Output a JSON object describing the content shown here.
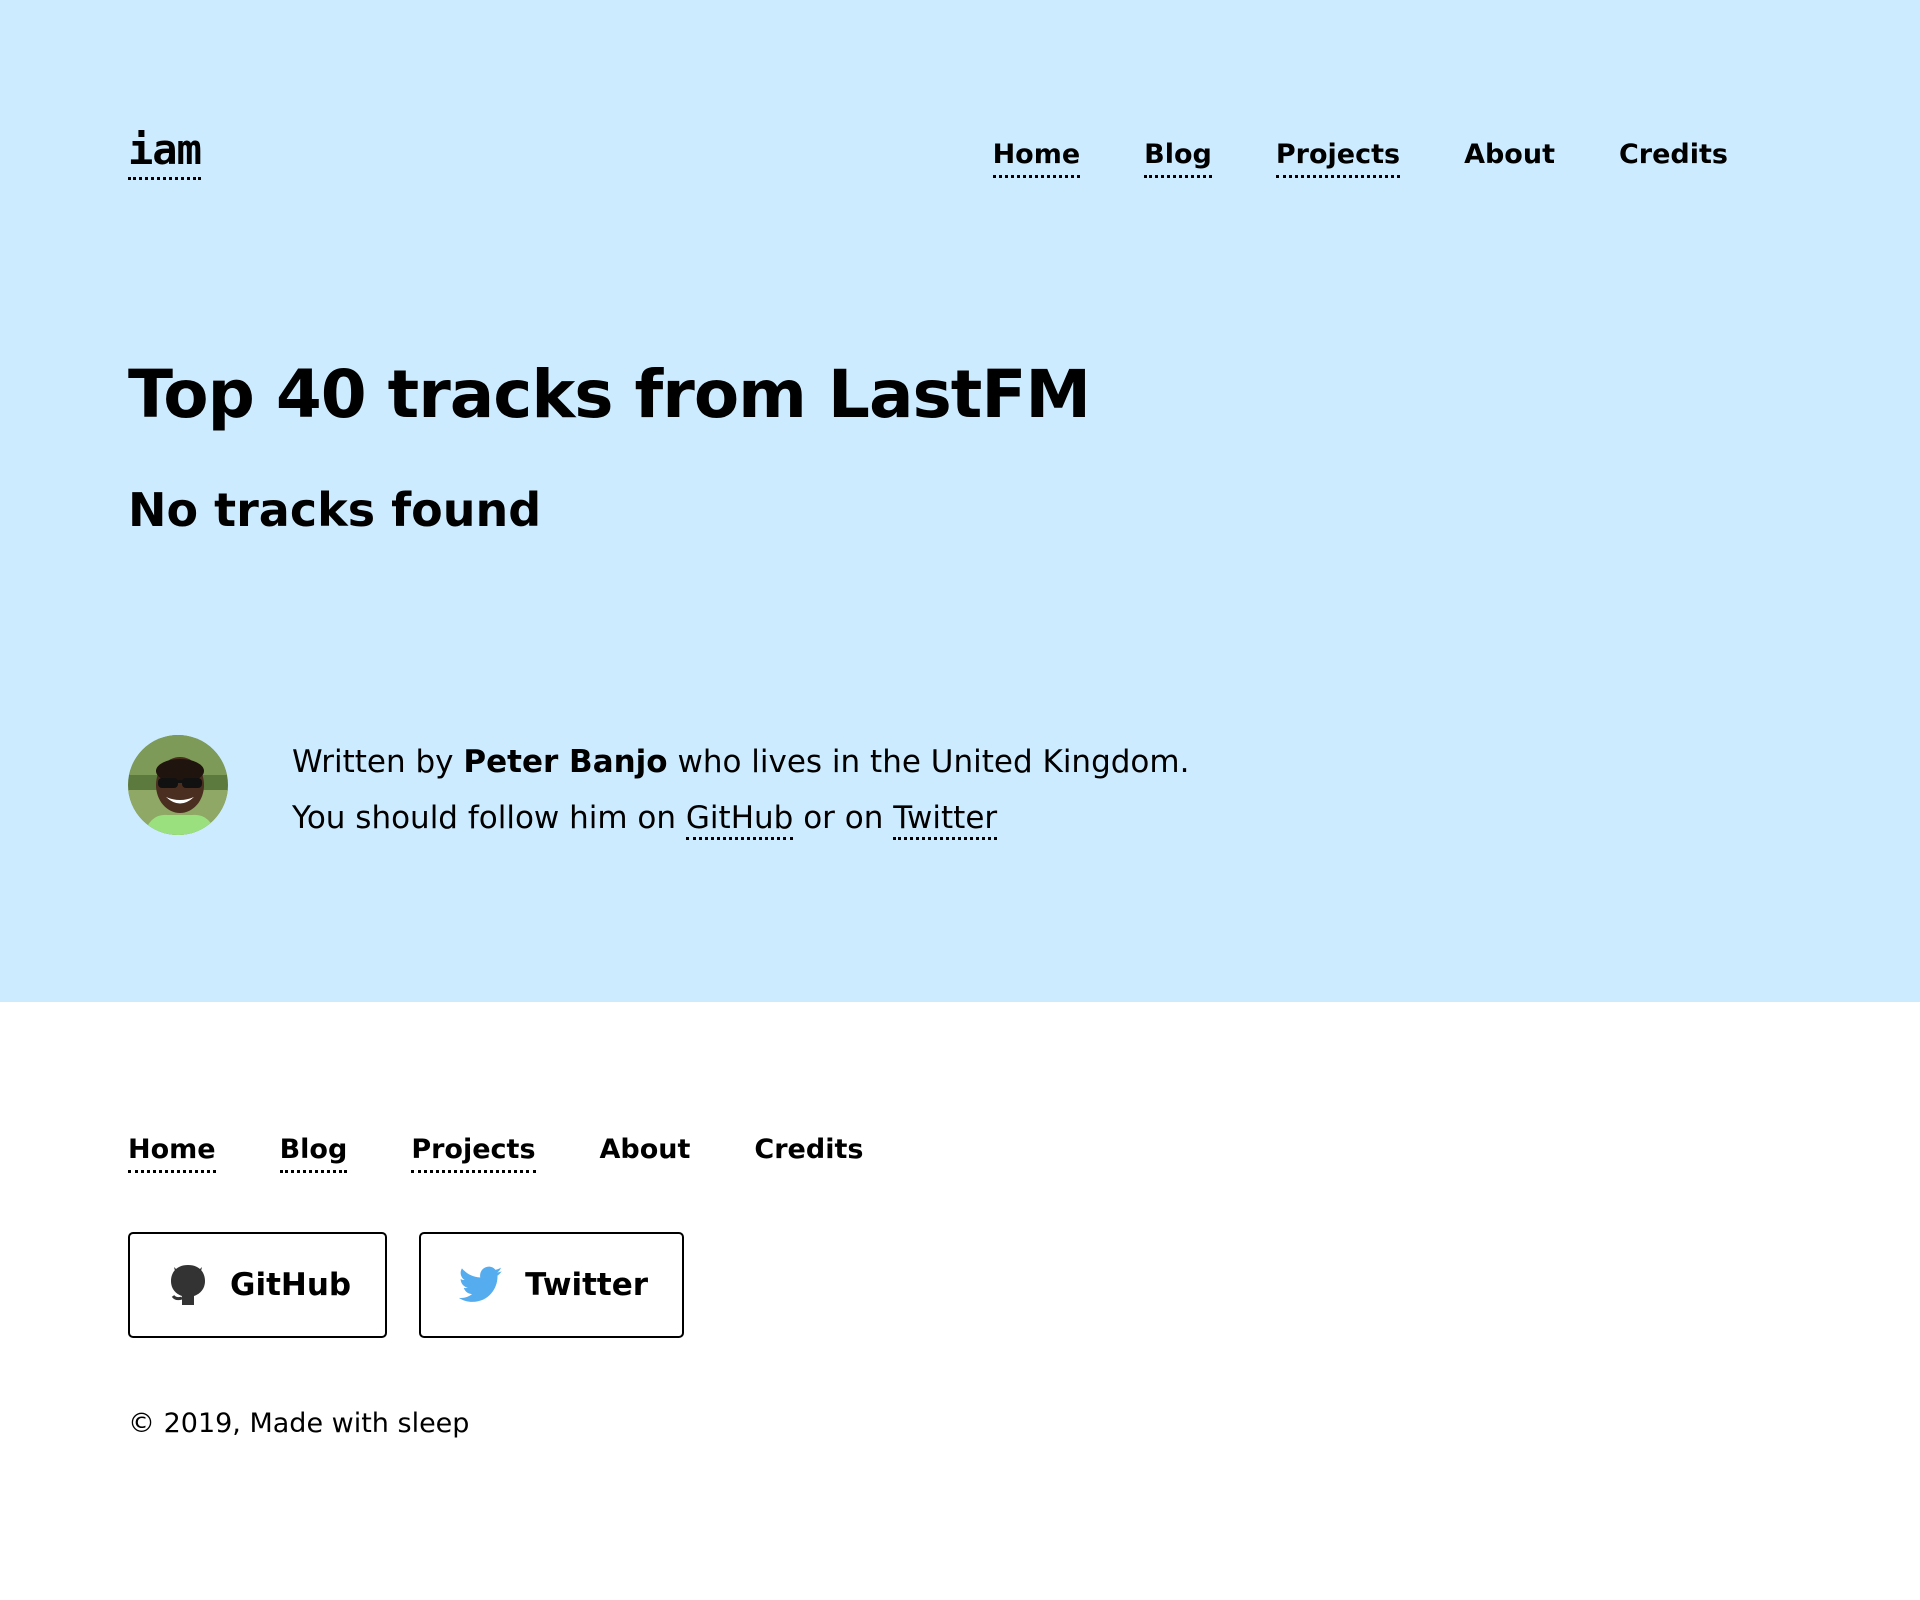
{
  "header": {
    "logo": "iam",
    "nav": [
      "Home",
      "Blog",
      "Projects",
      "About",
      "Credits"
    ]
  },
  "main": {
    "title": "Top 40 tracks from LastFM",
    "status": "No tracks found"
  },
  "author": {
    "written_by": "Written by ",
    "name": "Peter Banjo",
    "location_text": " who lives in the United Kingdom.",
    "follow_text": "You should follow him on ",
    "github_link": "GitHub",
    "or_text": " or on ",
    "twitter_link": "Twitter"
  },
  "footer": {
    "nav": [
      "Home",
      "Blog",
      "Projects",
      "About",
      "Credits"
    ],
    "social": [
      {
        "label": "GitHub",
        "icon": "github-icon"
      },
      {
        "label": "Twitter",
        "icon": "twitter-icon"
      }
    ],
    "copyright": "© 2019, Made with sleep"
  },
  "colors": {
    "hero_background": "#cdebfe",
    "page_background": "#ffffff",
    "text": "#000000",
    "twitter_blue": "#55acee",
    "github_gray": "#333333"
  }
}
